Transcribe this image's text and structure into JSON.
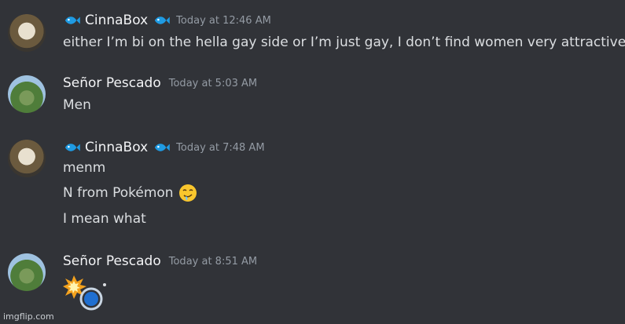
{
  "messages": [
    {
      "author": "CinnaBox",
      "timestamp": "Today at 12:46 AM",
      "lines": [
        "either I’m bi on the hella gay side or I’m just gay, I don’t find women very attractive"
      ]
    },
    {
      "author": "Señor Pescado",
      "timestamp": "Today at 5:03 AM",
      "lines": [
        "Men"
      ]
    },
    {
      "author": "CinnaBox",
      "timestamp": "Today at 7:48 AM",
      "lines": [
        "menm",
        "N from Pokémon",
        "I mean what"
      ]
    },
    {
      "author": "Señor Pescado",
      "timestamp": "Today at 8:51 AM",
      "lines": []
    }
  ],
  "icons": {
    "author_badge": "fish-icon",
    "emoji_drool": "drooling-face-emoji",
    "emoji_bomb": "collision-bomb-emoji"
  },
  "watermark": "imgflip.com",
  "colors": {
    "background": "#313338",
    "fish_badge": "#1f9be3"
  }
}
